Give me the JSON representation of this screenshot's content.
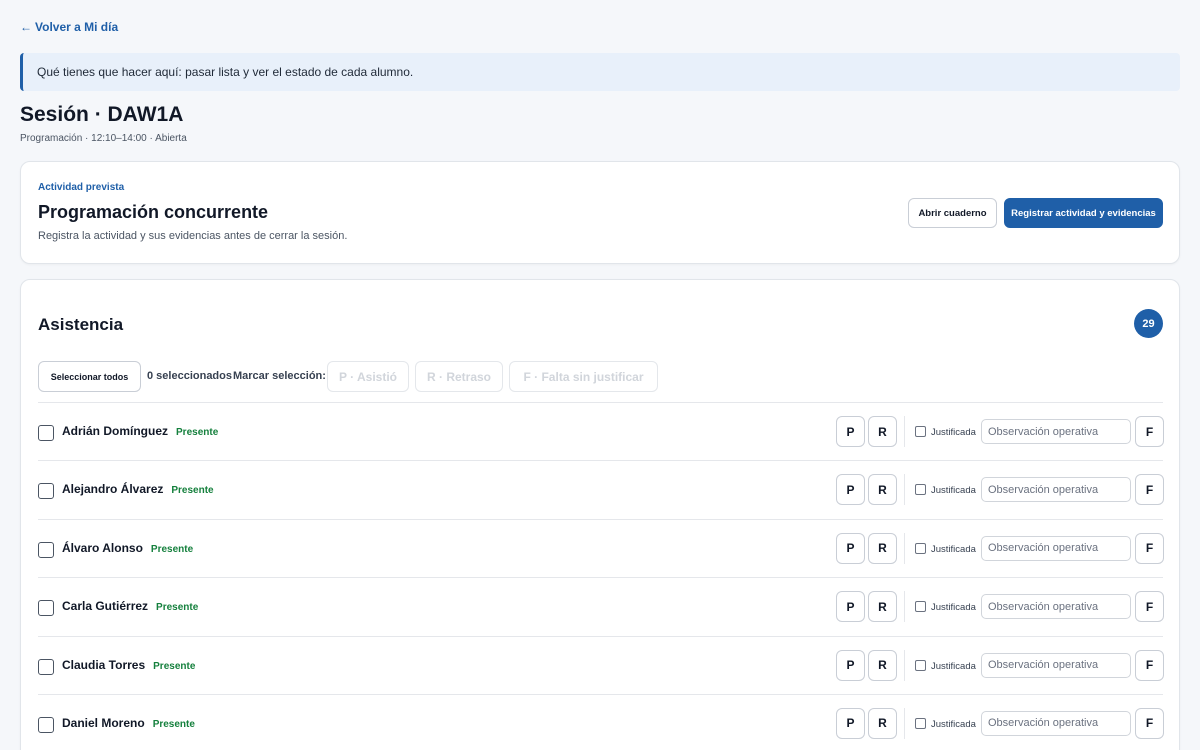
{
  "nav": {
    "back_arrow": "←",
    "back_label": "Volver a Mi día"
  },
  "banner": {
    "text": "Qué tienes que hacer aquí: pasar lista y ver el estado de cada alumno."
  },
  "session": {
    "title": "Sesión · DAW1A",
    "meta": "Programación · 12:10–14:00 · Abierta"
  },
  "activity": {
    "eyebrow": "Actividad prevista",
    "title": "Programación concurrente",
    "hint": "Registra la actividad y sus evidencias antes de cerrar la sesión.",
    "open_notebook_label": "Abrir cuaderno",
    "register_label": "Registrar actividad y evidencias"
  },
  "attendance": {
    "title": "Asistencia",
    "count": "29",
    "select_all_label": "Seleccionar todos",
    "selected_count": "0 seleccionados",
    "mark_label": "Marcar selección:",
    "bulk_present": "P · Asistió",
    "bulk_late": "R · Retraso",
    "bulk_absent": "F · Falta sin justificar",
    "justified_label": "Justificada",
    "observation_placeholder": "Observación operativa",
    "present_button": "P",
    "late_button": "R",
    "absent_button": "F",
    "students": [
      {
        "name": "Adrián Domínguez",
        "status": "Presente"
      },
      {
        "name": "Alejandro Álvarez",
        "status": "Presente"
      },
      {
        "name": "Álvaro Alonso",
        "status": "Presente"
      },
      {
        "name": "Carla Gutiérrez",
        "status": "Presente"
      },
      {
        "name": "Claudia Torres",
        "status": "Presente"
      },
      {
        "name": "Daniel Moreno",
        "status": "Presente"
      }
    ]
  },
  "colors": {
    "accent": "#1f5fa8",
    "status_present": "#15803d",
    "banner_bg": "#e8f0fa",
    "page_bg": "#f5f7fa"
  }
}
